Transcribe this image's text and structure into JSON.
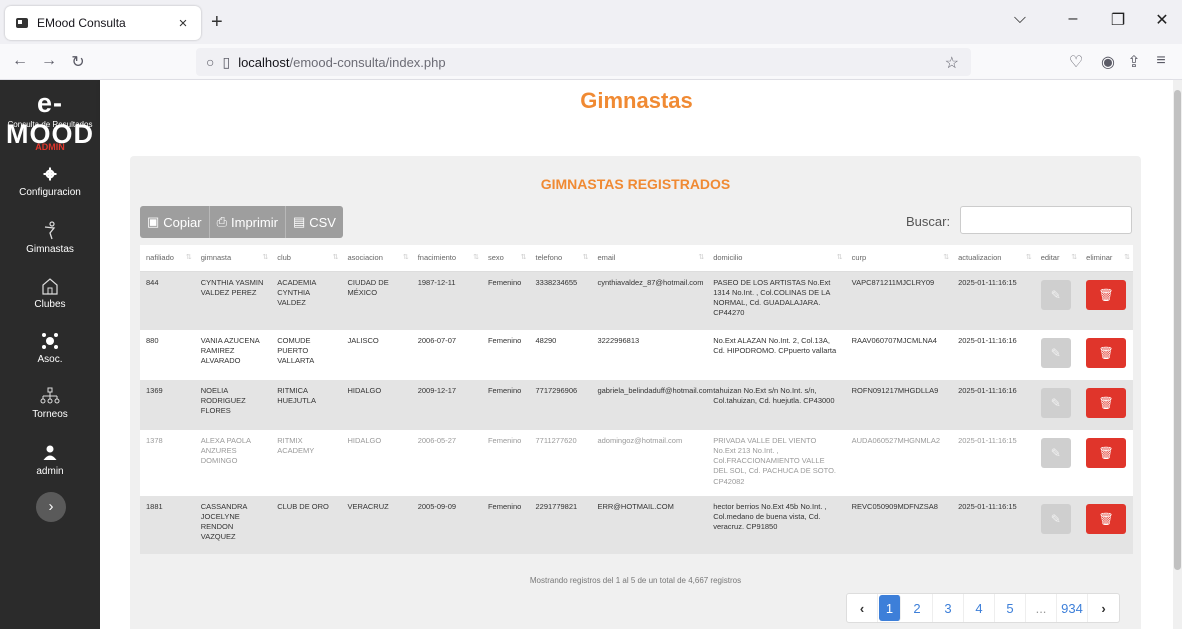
{
  "browser": {
    "tab_title": "EMood Consulta",
    "url_host": "localhost",
    "url_path": "/emood-consulta/index.php"
  },
  "sidebar": {
    "logo": "e-MOOD",
    "logo_sub": "Consulta de Resultados",
    "role": "ADMIN",
    "items": [
      {
        "label": "Configuracion",
        "icon": "gear-icon"
      },
      {
        "label": "Gimnastas",
        "icon": "gymnast-icon"
      },
      {
        "label": "Clubes",
        "icon": "building-icon"
      },
      {
        "label": "Asoc.",
        "icon": "network-icon"
      },
      {
        "label": "Torneos",
        "icon": "sitemap-icon"
      },
      {
        "label": "admin",
        "icon": "user-icon"
      }
    ]
  },
  "page": {
    "title": "Gimnastas",
    "card_title": "GIMNASTAS REGISTRADOS"
  },
  "toolbar": {
    "copy": "Copiar",
    "print": "Imprimir",
    "csv": "CSV",
    "search_label": "Buscar:",
    "search_value": ""
  },
  "table": {
    "headers": [
      "nafiliado",
      "gimnasta",
      "club",
      "asociacion",
      "fnacimiento",
      "sexo",
      "telefono",
      "email",
      "domicilio",
      "curp",
      "actualizacion",
      "editar",
      "eliminar"
    ],
    "rows": [
      {
        "nafiliado": "844",
        "gimnasta": "CYNTHIA YASMIN VALDEZ PEREZ",
        "club": "ACADEMIA CYNTHIA VALDEZ",
        "asociacion": "CIUDAD DE MÉXICO",
        "fnacimiento": "1987-12-11",
        "sexo": "Femenino",
        "telefono": "3338234655",
        "email": "cynthiavaldez_87@hotmail.com",
        "domicilio": "PASEO DE LOS ARTISTAS No.Ext 1314 No.Int. , Col.COLINAS DE LA NORMAL, Cd. GUADALAJARA. CP44270",
        "curp": "VAPC871211MJCLRY09",
        "actualizacion": "2025-01-11:16:15"
      },
      {
        "nafiliado": "880",
        "gimnasta": "VANIA AZUCENA RAMIREZ ALVARADO",
        "club": "COMUDE PUERTO VALLARTA",
        "asociacion": "JALISCO",
        "fnacimiento": "2006-07-07",
        "sexo": "Femenino",
        "telefono": "48290",
        "email": "3222996813",
        "domicilio": "No.Ext ALAZAN No.Int. 2, Col.13A, Cd. HIPODROMO. CPpuerto vallarta",
        "curp": "RAAV060707MJCMLNA4",
        "actualizacion": "2025-01-11:16:16"
      },
      {
        "nafiliado": "1369",
        "gimnasta": "NOELIA RODRIGUEZ FLORES",
        "club": "RITMICA HUEJUTLA",
        "asociacion": "HIDALGO",
        "fnacimiento": "2009-12-17",
        "sexo": "Femenino",
        "telefono": "7717296906",
        "email": "gabriela_belindaduff@hotmail.com",
        "domicilio": "tahuizan No.Ext s/n No.Int. s/n, Col.tahuizan, Cd. huejutla. CP43000",
        "curp": "ROFN091217MHGDLLA9",
        "actualizacion": "2025-01-11:16:16"
      },
      {
        "nafiliado": "1378",
        "gimnasta": "ALEXA PAOLA ANZURES DOMINGO",
        "club": "RITMIX ACADEMY",
        "asociacion": "HIDALGO",
        "fnacimiento": "2006-05-27",
        "sexo": "Femenino",
        "telefono": "7711277620",
        "email": "adomingoz@hotmail.com",
        "domicilio": "PRIVADA VALLE DEL VIENTO No.Ext 213 No.Int. , Col.FRACCIONAMIENTO VALLE DEL SOL, Cd. PACHUCA DE SOTO. CP42082",
        "curp": "AUDA060527MHGNMLA2",
        "actualizacion": "2025-01-11:16:15"
      },
      {
        "nafiliado": "1881",
        "gimnasta": "CASSANDRA JOCELYNE RENDON VAZQUEZ",
        "club": "CLUB DE ORO",
        "asociacion": "VERACRUZ",
        "fnacimiento": "2005-09-09",
        "sexo": "Femenino",
        "telefono": "2291779821",
        "email": "ERR@HOTMAIL.COM",
        "domicilio": "hector berrios No.Ext 45b No.Int. , Col.medano de buena vista, Cd. veracruz. CP91850",
        "curp": "REVC050909MDFNZSA8",
        "actualizacion": "2025-01-11:16:15"
      }
    ]
  },
  "footer": {
    "info": "Mostrando registros del 1 al 5 de un total de 4,667 registros",
    "pages": [
      "1",
      "2",
      "3",
      "4",
      "5",
      "...",
      "934"
    ],
    "prev": "‹",
    "next": "›"
  },
  "colors": {
    "accent": "#f08a33",
    "sidebar": "#2b2b2b",
    "danger": "#e0352b",
    "primary": "#3d7fd9"
  }
}
